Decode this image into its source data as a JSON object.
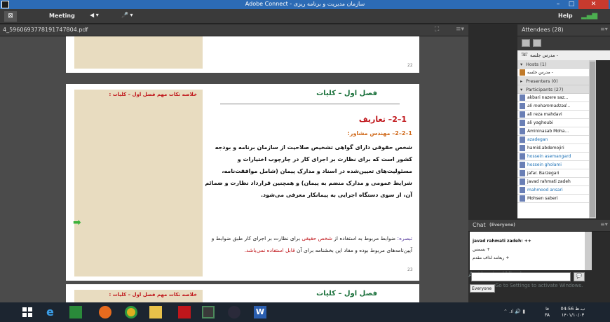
{
  "window": {
    "title": "Adobe Connect - سازمان مدیریت و برنامه ریزی",
    "min": "–",
    "max": "□",
    "close": "✕"
  },
  "menubar": {
    "meeting": "Meeting",
    "help": "Help",
    "audio": "◀ ▾",
    "mic": "🎤 ▾",
    "signal": "▂▄▆"
  },
  "share": {
    "filename": "4_5960693778191747804.pdf",
    "page1_num": "22",
    "page2_num": "23",
    "sidebar_title": "خلاصه نکات مهم فصل اول – کلیات :",
    "chapter": "فصل اول – کلیات",
    "section": "1–2– تعاریف",
    "subsection": "1–2–2– مهندس مشاور:",
    "paragraph": "شخص حقوقی دارای گواهی تشخیص صلاحیت از سازمان برنامه و بودجه کشور است که برای نظارت بر اجرای کار در چارچوب اختیارات و مسئولیت‌های تعیین‌شده در اسناد و مدارک پیمان (شامل موافقت‌نامه، شرایط عمومی و مدارک منضم به پیمان) و همچنین قرارداد نظارت و ضمائم آن، از سوی دستگاه اجرایی به پیمانکار معرفی می‌شود.",
    "note_label": "تبصره:",
    "note_part1": " ضوابط مربوط به استفاده از ",
    "note_red1": "شخص حقیقی",
    "note_part2": " برای نظارت بر اجرای کار طبق ضوابط و آیین‌نامه‌های مربوط بوده و مفاد این بخشنامه برای آن ",
    "note_red2": "قابل استفاده نمی‌باشد.",
    "page3_chapter": "فصل اول – کلیات",
    "arrow": "➡"
  },
  "attendees": {
    "title": "Attendees",
    "count": "(28)",
    "current_user": "مدرس جلسه -",
    "hosts_label": "Hosts (1)",
    "presenters_label": "Presenters (0)",
    "participants_label": "Participants (27)",
    "host_name": "مدرس جلسه -",
    "participants": [
      "akbari nazere saz...",
      "ali mohammadzad...",
      "ali reza mahdavi",
      "ali yaghoubi",
      "Amininasab  Moha...",
      "azadegan",
      "hamid.abdemojiri",
      "hossein asemangard",
      "hossein gholami",
      "jafar. Barzegari",
      "javad rahmati zadeh",
      "mahmood ansari",
      "Mohsen saberi"
    ]
  },
  "chat": {
    "title": "Chat",
    "scope": "(Everyone)",
    "messages": [
      "javad rahmati zadeh: ++",
      "+ بسمس",
      "+ ربعامد لذاف مقدم"
    ],
    "recipient": "Everyone",
    "send": "💬",
    "watermark": "Activate Windows",
    "watermark_sub": "Go to Settings to activate Windows."
  },
  "taskbar": {
    "ime": "فا",
    "lang": "FA",
    "time": "04:56 ب.ظ",
    "date": "۱۴۰۱/۱۰/۰۳"
  },
  "colors": {
    "titlebar": "#2c6bb5",
    "close": "#c83a2e",
    "sidebar_beige": "#e8dcc0",
    "accent_red": "#c0161b",
    "accent_green": "#19703a"
  }
}
